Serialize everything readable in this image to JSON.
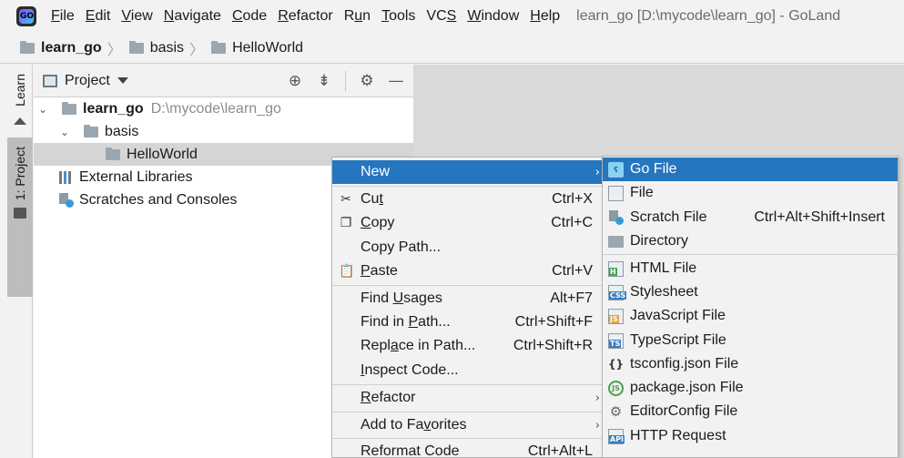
{
  "menubar": {
    "items": [
      {
        "label": "File",
        "mnemonic": "F"
      },
      {
        "label": "Edit",
        "mnemonic": "E"
      },
      {
        "label": "View",
        "mnemonic": "V"
      },
      {
        "label": "Navigate",
        "mnemonic": "N"
      },
      {
        "label": "Code",
        "mnemonic": "C"
      },
      {
        "label": "Refactor",
        "mnemonic": "R"
      },
      {
        "label": "Run",
        "mnemonic": "u"
      },
      {
        "label": "Tools",
        "mnemonic": "T"
      },
      {
        "label": "VCS",
        "mnemonic": "S"
      },
      {
        "label": "Window",
        "mnemonic": "W"
      },
      {
        "label": "Help",
        "mnemonic": "H"
      }
    ],
    "window_title": "learn_go [D:\\mycode\\learn_go] - GoLand"
  },
  "breadcrumb": [
    "learn_go",
    "basis",
    "HelloWorld"
  ],
  "toolstrip": {
    "learn": "Learn",
    "project": "1: Project"
  },
  "project_panel": {
    "title": "Project",
    "tree": {
      "root": {
        "name": "learn_go",
        "path": "D:\\mycode\\learn_go"
      },
      "basis": "basis",
      "helloworld": "HelloWorld",
      "external_libraries": "External Libraries",
      "scratches": "Scratches and Consoles"
    }
  },
  "context_menu": {
    "new": "New",
    "cut": {
      "label": "Cut",
      "shortcut": "Ctrl+X"
    },
    "copy": {
      "label": "Copy",
      "shortcut": "Ctrl+C"
    },
    "copy_path": "Copy Path...",
    "paste": {
      "label": "Paste",
      "shortcut": "Ctrl+V"
    },
    "find_usages": {
      "label": "Find Usages",
      "shortcut": "Alt+F7"
    },
    "find_in_path": {
      "label": "Find in Path...",
      "shortcut": "Ctrl+Shift+F"
    },
    "replace_in_path": {
      "label": "Replace in Path...",
      "shortcut": "Ctrl+Shift+R"
    },
    "inspect_code": "Inspect Code...",
    "refactor": "Refactor",
    "add_to_favorites": "Add to Favorites",
    "reformat_code": {
      "label": "Reformat Code",
      "shortcut": "Ctrl+Alt+L"
    }
  },
  "new_submenu": {
    "go_file": "Go File",
    "file": "File",
    "scratch_file": {
      "label": "Scratch File",
      "shortcut": "Ctrl+Alt+Shift+Insert"
    },
    "directory": "Directory",
    "html_file": "HTML File",
    "stylesheet": "Stylesheet",
    "javascript_file": "JavaScript File",
    "typescript_file": "TypeScript File",
    "tsconfig": "tsconfig.json File",
    "package_json": "package.json File",
    "editorconfig": "EditorConfig File",
    "http_request": "HTTP Request"
  },
  "colors": {
    "selection": "#2675bf",
    "tree_selected": "#d5d5d5"
  }
}
